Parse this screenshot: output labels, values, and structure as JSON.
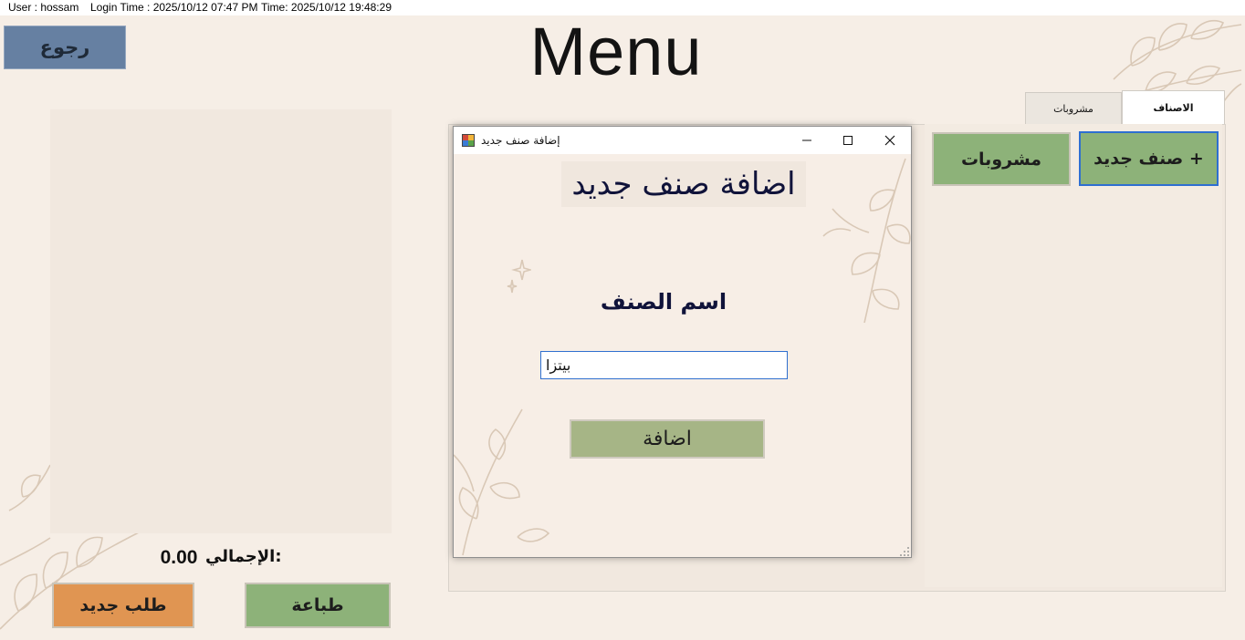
{
  "status_bar": {
    "user": "User : hossam",
    "login_time": "Login Time :  2025/10/12 07:47 PM",
    "time": "Time: 2025/10/12 19:48:29"
  },
  "main": {
    "title": "Menu",
    "back_label": "رجوع",
    "total_caption": "الإجمالي:",
    "total_value": "0.00",
    "new_order_label": "طلب جديد",
    "print_label": "طباعة"
  },
  "tabs": [
    {
      "label": "الاصناف",
      "selected": true
    },
    {
      "label": "مشروبات",
      "selected": false
    }
  ],
  "tab_content": {
    "buttons": [
      {
        "label": "صنف جديد +",
        "focused": true
      },
      {
        "label": "مشروبات",
        "focused": false
      }
    ]
  },
  "dialog": {
    "title": "إضافة صنف جديد",
    "heading": "اضافة صنف جديد",
    "field_label": "اسم الصنف",
    "field_value": "بيتزا",
    "submit_label": "اضافة"
  },
  "colors": {
    "background": "#f6eee6",
    "green_button": "#8db279",
    "orange_button": "#e09552",
    "back_button": "#6680a2",
    "dialog_heading_text": "#10133a",
    "focus_border": "#2e6fd1"
  },
  "icons": [
    "window-app-icon",
    "minimize-icon",
    "maximize-icon",
    "close-icon",
    "resize-grip-icon"
  ]
}
